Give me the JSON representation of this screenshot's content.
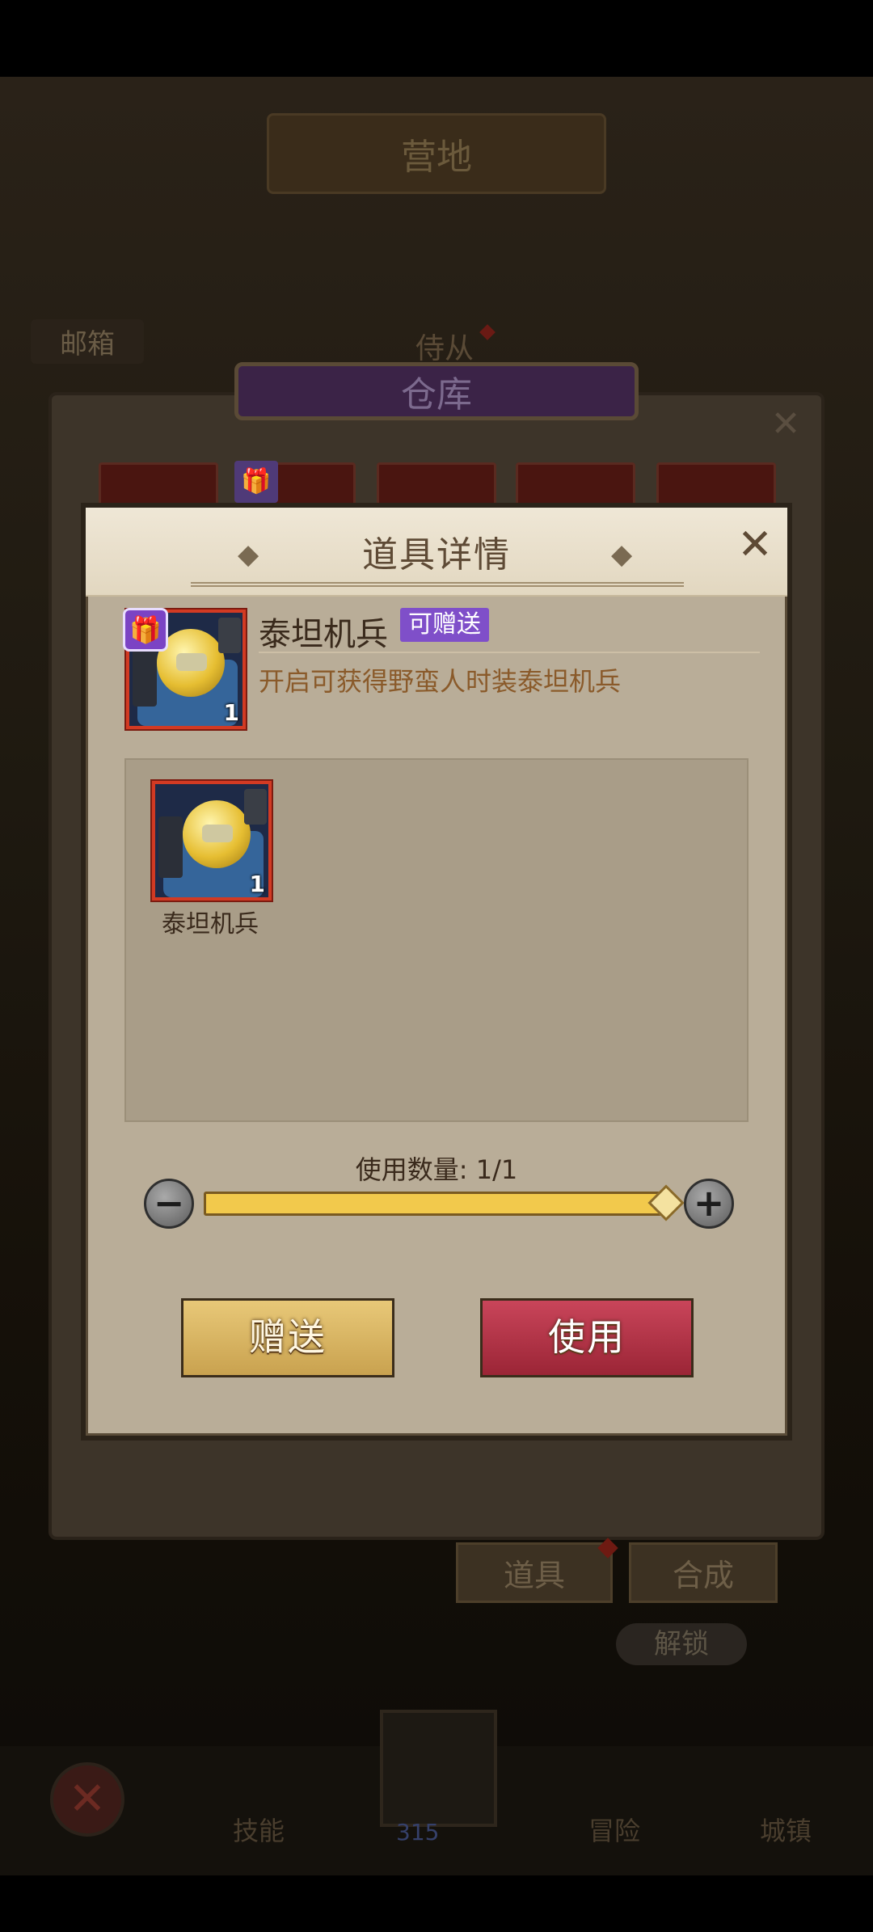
{
  "background": {
    "title": "营地",
    "mail_label": "邮箱",
    "follower_label": "侍从",
    "warehouse_title": "仓库",
    "warehouse_close": "✕",
    "gift_glyph": "🎁",
    "tabs": [
      "道具",
      "合成"
    ],
    "unlock_label": "解锁",
    "nav": {
      "skills": "技能",
      "adventure": "冒险",
      "city": "城镇",
      "close": "✕",
      "count": "315"
    }
  },
  "dialog": {
    "title": "道具详情",
    "ornament_left": "◆",
    "ornament_right": "◆",
    "close": "✕",
    "item": {
      "name": "泰坦机兵",
      "tag": "可赠送",
      "description": "开启可获得野蛮人时装泰坦机兵",
      "quantity": "1",
      "gift_glyph": "🎁"
    },
    "rewards": [
      {
        "name": "泰坦机兵",
        "quantity": "1"
      }
    ],
    "use_quantity_label": "使用数量: 1/1",
    "slider_value": 1.0,
    "minus": "−",
    "plus": "+",
    "buttons": {
      "gift": "赠送",
      "use": "使用"
    }
  },
  "colors": {
    "gift_purple": "#7f4fc9",
    "use_red": "#9b2536",
    "gift_gold": "#c9a24f",
    "frame_red": "#d23a23"
  }
}
